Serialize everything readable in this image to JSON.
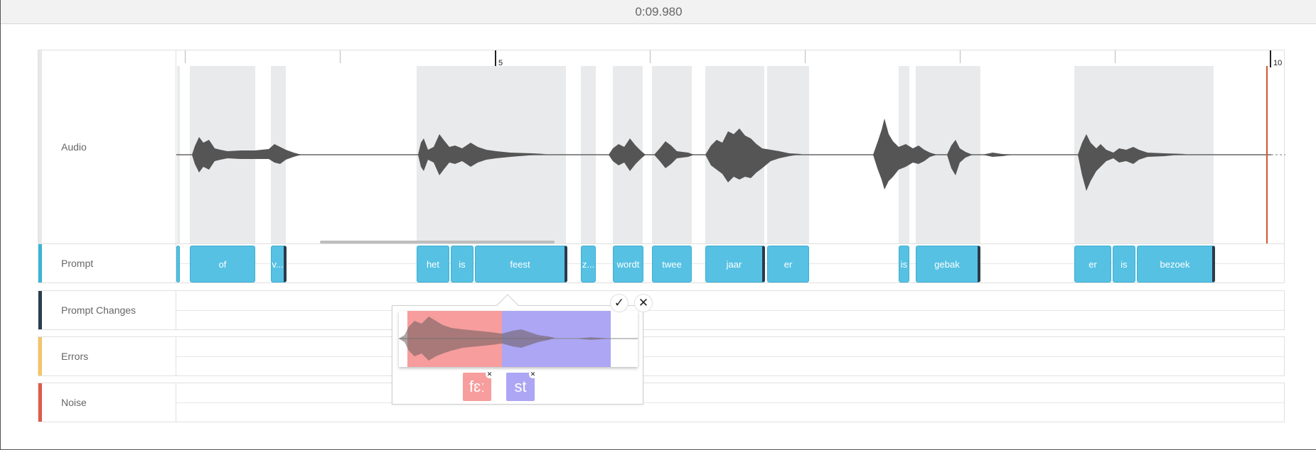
{
  "header": {
    "time": "0:09.980"
  },
  "tracks": {
    "audio": {
      "label": "Audio"
    },
    "prompt": {
      "label": "Prompt",
      "color": "#3ab5d6"
    },
    "changes": {
      "label": "Prompt Changes",
      "color": "#2c3e50"
    },
    "errors": {
      "label": "Errors",
      "color": "#f5c466"
    },
    "noise": {
      "label": "Noise",
      "color": "#de5b49"
    }
  },
  "ruler": {
    "labels": [
      "5",
      "10"
    ]
  },
  "prompt_words": [
    "of",
    "v...",
    "het",
    "is",
    "feest",
    "z...",
    "wordt",
    "twee",
    "jaar",
    "er",
    "is",
    "gebak",
    "er",
    "is",
    "bezoek"
  ],
  "popover": {
    "phones": [
      {
        "label": "fɛː",
        "color": "#f79d9d"
      },
      {
        "label": "st",
        "color": "#ada6f4"
      }
    ],
    "confirm_label": "✓",
    "close_label": "✕"
  },
  "colors": {
    "chip": "#56c1e3",
    "playhead": "#d2552e",
    "waveform": "#555555"
  }
}
